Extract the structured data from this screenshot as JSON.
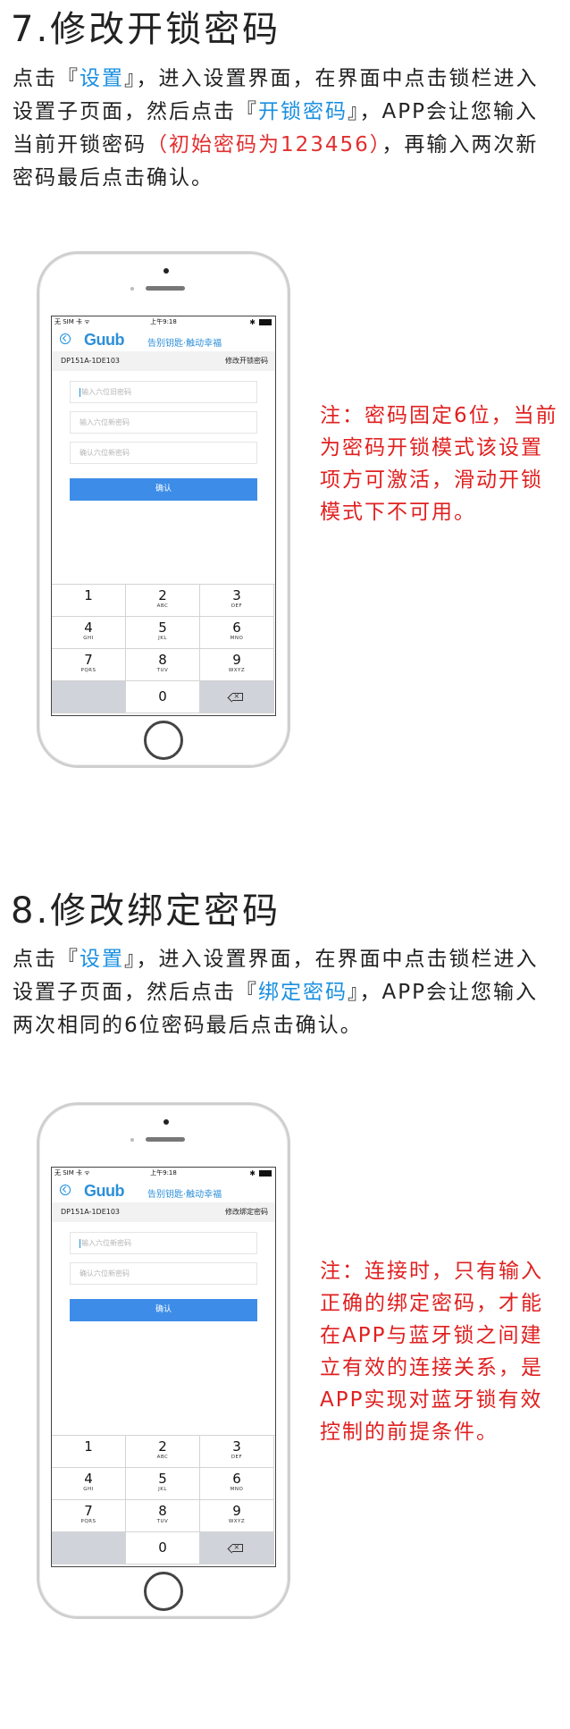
{
  "section7": {
    "title": "7.修改开锁密码",
    "para": [
      {
        "t": "点击『",
        "c": ""
      },
      {
        "t": "设置",
        "c": "blue"
      },
      {
        "t": "』，进入设置界面，在界面中点击锁栏进入设置子页面，然后点击『",
        "c": ""
      },
      {
        "t": "开锁密码",
        "c": "blue"
      },
      {
        "t": "』，APP会让您输入当前开锁密码",
        "c": ""
      },
      {
        "t": "（初始密码为123456）",
        "c": "red"
      },
      {
        "t": "，再输入两次新密码最后点击确认。",
        "c": ""
      }
    ],
    "note": "注：密码固定6位，当前为密码开锁模式该设置项方可激活，滑动开锁模式下不可用。",
    "phone": {
      "status_left": "无 SIM 卡 ᯤ",
      "status_time": "上午9:18",
      "logo": "Guub",
      "slogan": "告别钥匙·触动幸福",
      "device_id": "DP151A-1DE103",
      "action_label": "修改开锁密码",
      "fields": [
        "输入六位旧密码",
        "输入六位新密码",
        "确认六位新密码"
      ],
      "confirm_label": "确认"
    }
  },
  "section8": {
    "title": "8.修改绑定密码",
    "para": [
      {
        "t": "点击『",
        "c": ""
      },
      {
        "t": "设置",
        "c": "blue"
      },
      {
        "t": "』，进入设置界面，在界面中点击锁栏进入设置子页面，然后点击『",
        "c": ""
      },
      {
        "t": "绑定密码",
        "c": "blue"
      },
      {
        "t": "』，APP会让您输入两次相同的6位密码最后点击确认。",
        "c": ""
      }
    ],
    "note": "注：连接时，只有输入正确的绑定密码，才能在APP与蓝牙锁之间建立有效的连接关系，是APP实现对蓝牙锁有效控制的前提条件。",
    "phone": {
      "status_left": "无 SIM 卡 ᯤ",
      "status_time": "上午9:18",
      "logo": "Guub",
      "slogan": "告别钥匙·触动幸福",
      "device_id": "DP151A-1DE103",
      "action_label": "修改绑定密码",
      "fields": [
        "输入六位新密码",
        "确认六位新密码"
      ],
      "confirm_label": "确认"
    }
  },
  "keypad": [
    {
      "num": "1",
      "letters": ""
    },
    {
      "num": "2",
      "letters": "ABC"
    },
    {
      "num": "3",
      "letters": "DEF"
    },
    {
      "num": "4",
      "letters": "GHI"
    },
    {
      "num": "5",
      "letters": "JKL"
    },
    {
      "num": "6",
      "letters": "MNO"
    },
    {
      "num": "7",
      "letters": "PQRS"
    },
    {
      "num": "8",
      "letters": "TUV"
    },
    {
      "num": "9",
      "letters": "WXYZ"
    },
    {
      "num": "0",
      "letters": ""
    }
  ],
  "colors": {
    "accent": "#1a8fe0",
    "note": "#e02020",
    "button": "#3d8de8"
  }
}
